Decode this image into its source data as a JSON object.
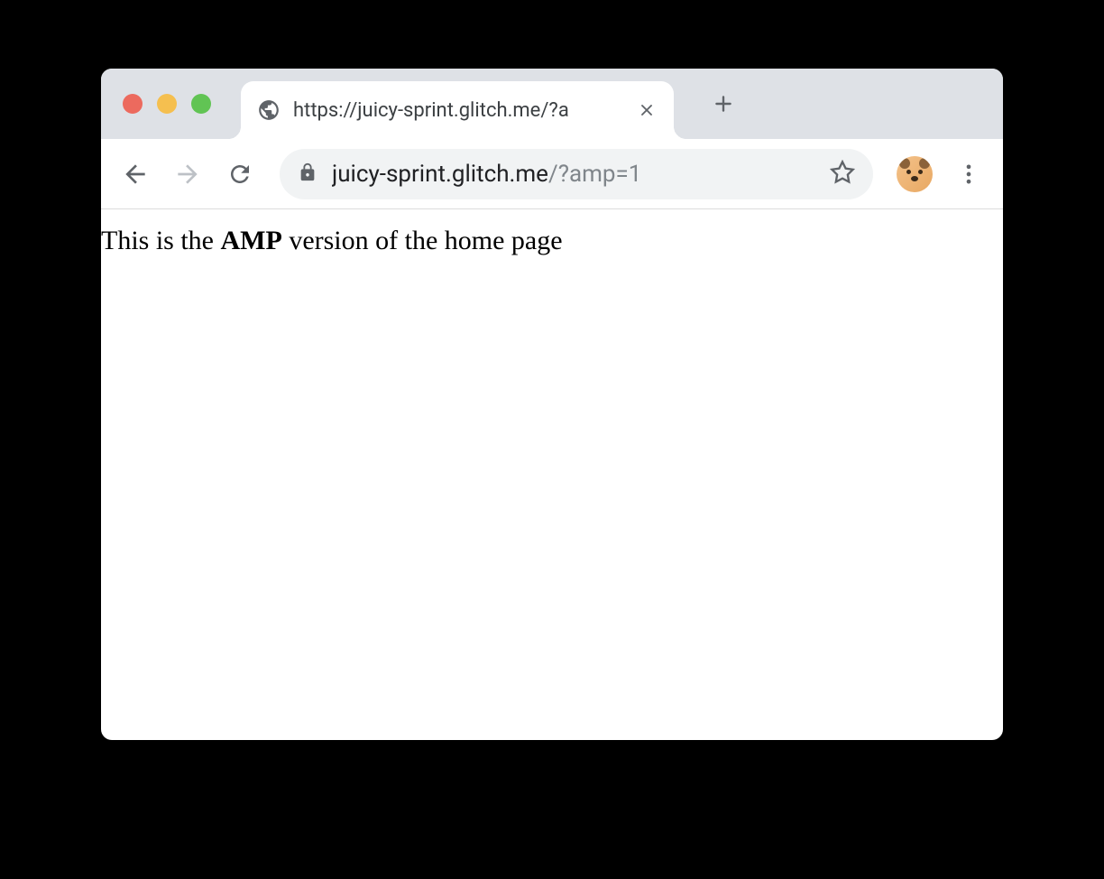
{
  "tab": {
    "title": "https://juicy-sprint.glitch.me/?a"
  },
  "addressBar": {
    "host": "juicy-sprint.glitch.me",
    "query": "/?amp=1"
  },
  "page": {
    "text_before": "This is the ",
    "text_bold": "AMP",
    "text_after": " version of the home page"
  }
}
